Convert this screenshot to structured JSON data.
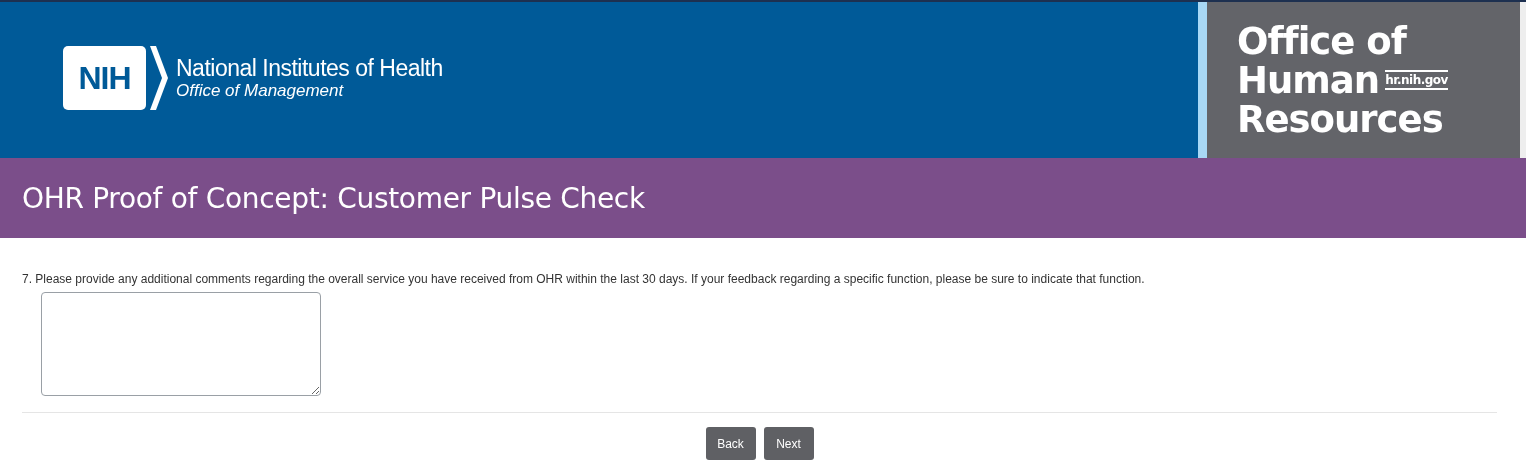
{
  "header": {
    "logo_mark": "NIH",
    "org_name": "National Institutes of Health",
    "org_unit": "Office of Management",
    "ohr_logo": {
      "line_1": "Office of",
      "line_2": "Human",
      "url": "hr.nih.gov",
      "line_3": "Resources"
    }
  },
  "survey_title": "OHR Proof of Concept: Customer Pulse Check",
  "question": {
    "text": "7. Please provide any additional comments regarding the overall service you have received from OHR within the last 30 days. If your feedback regarding a specific function, please be sure to indicate that function."
  },
  "buttons": [
    {
      "label": "Back"
    },
    {
      "label": "Next"
    }
  ]
}
